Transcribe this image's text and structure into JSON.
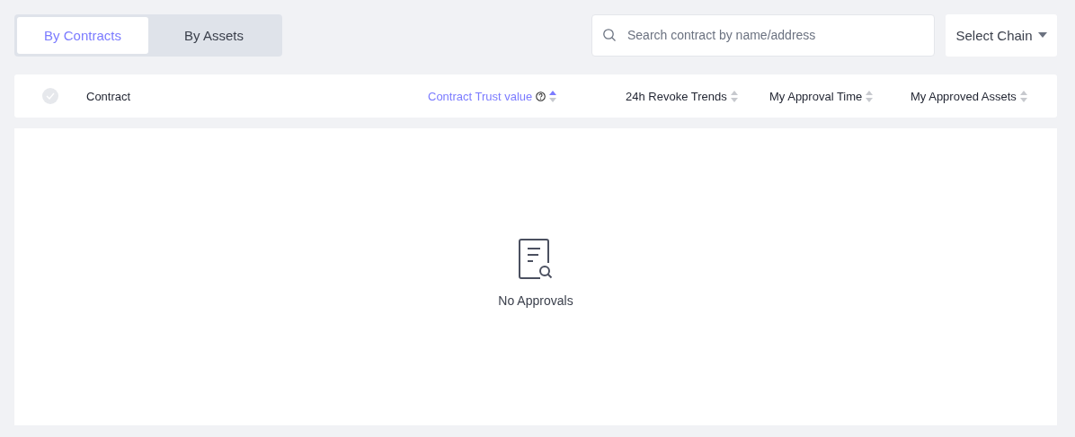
{
  "tabs": [
    {
      "label": "By Contracts",
      "selected": true
    },
    {
      "label": "By Assets",
      "selected": false
    }
  ],
  "search": {
    "placeholder": "Search contract by name/address"
  },
  "chain_select": {
    "label": "Select Chain"
  },
  "table": {
    "select_all": {
      "checked": false
    },
    "columns": [
      {
        "kind": "plain",
        "label": "Contract",
        "highlighted": false
      },
      {
        "kind": "help_sortable",
        "label": "Contract Trust value",
        "highlighted": true,
        "sort_asc": true
      },
      {
        "kind": "sortable",
        "label": "24h Revoke Trends",
        "highlighted": false,
        "sort_asc": false
      },
      {
        "kind": "sortable",
        "label": "My Approval Time",
        "highlighted": false,
        "sort_asc": false
      },
      {
        "kind": "sortable",
        "label": "My Approved Assets",
        "highlighted": false,
        "sort_asc": false
      }
    ],
    "empty_text": "No Approvals"
  }
}
